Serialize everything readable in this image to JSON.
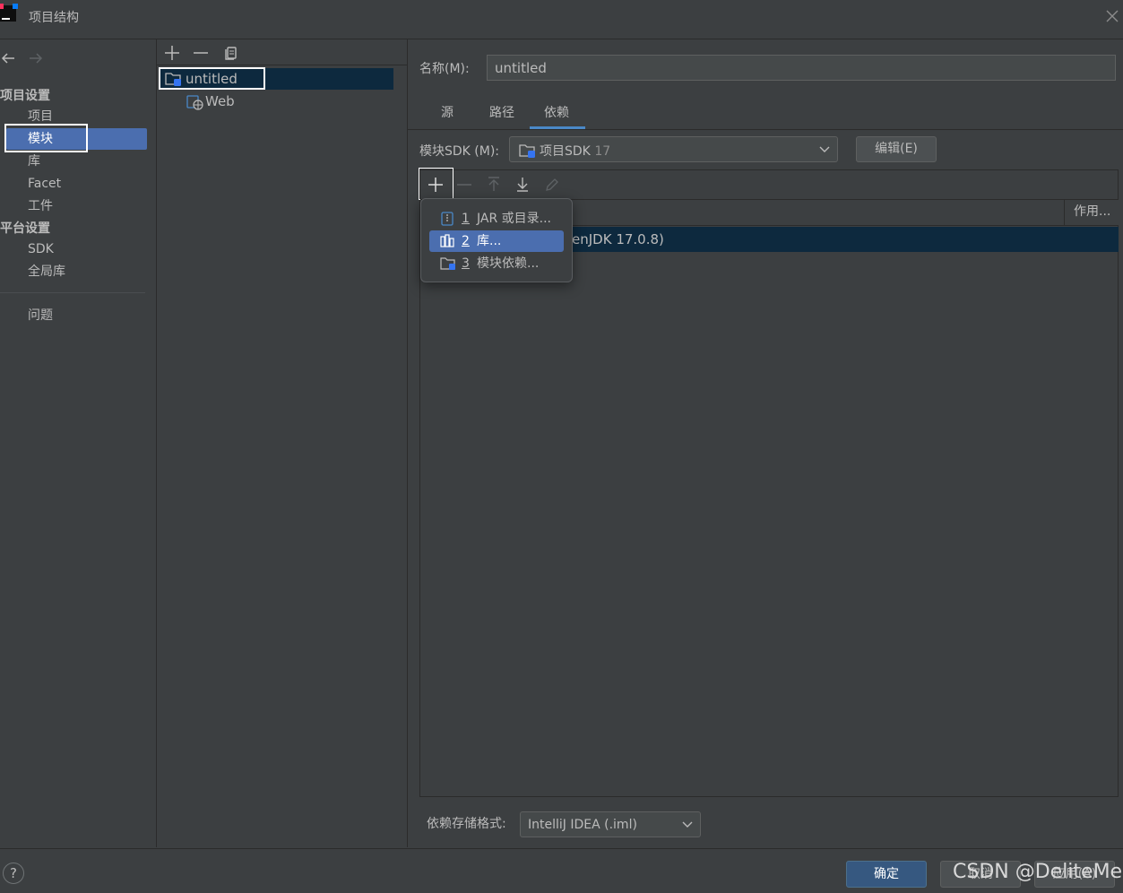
{
  "window": {
    "title": "项目结构"
  },
  "nav": {
    "back_icon": "arrow-left-icon",
    "forward_icon": "arrow-right-icon",
    "project_settings_header": "项目设置",
    "project_settings_items": [
      {
        "label": "项目"
      },
      {
        "label": "模块",
        "selected": true
      },
      {
        "label": "库"
      },
      {
        "label": "Facet"
      },
      {
        "label": "工件"
      }
    ],
    "platform_settings_header": "平台设置",
    "platform_settings_items": [
      {
        "label": "SDK"
      },
      {
        "label": "全局库"
      }
    ],
    "problems_label": "问题"
  },
  "tree": {
    "toolbar": [
      "plus-icon",
      "minus-icon",
      "copy-icon"
    ],
    "root": "untitled",
    "child": "Web"
  },
  "module": {
    "name_label": "名称(M):",
    "name_value": "untitled",
    "tabs": [
      {
        "label": "源"
      },
      {
        "label": "路径"
      },
      {
        "label": "依赖",
        "active": true
      }
    ],
    "sdk_label": "模块SDK (M):",
    "sdk_value": "项目SDK",
    "sdk_version": "17",
    "edit_button": "编辑(E)",
    "scope_header": "作用...",
    "dep_row_text": "enJDK 17.0.8)",
    "popup": [
      {
        "num": "1",
        "label": "JAR 或目录..."
      },
      {
        "num": "2",
        "label": "库...",
        "selected": true
      },
      {
        "num": "3",
        "label": "模块依赖..."
      }
    ],
    "storage_format_label": "依赖存储格式:",
    "storage_format_value": "IntelliJ IDEA (.iml)"
  },
  "footer": {
    "help": "?",
    "ok": "确定",
    "cancel": "取消",
    "apply": "应用(A)",
    "watermark": "CSDN @DeliteMe"
  },
  "colors": {
    "background": "#3c3f41",
    "selection": "#4b6eaf",
    "tree_selection": "#0d293e",
    "primary_button": "#365880",
    "tab_underline": "#4a88c7"
  }
}
